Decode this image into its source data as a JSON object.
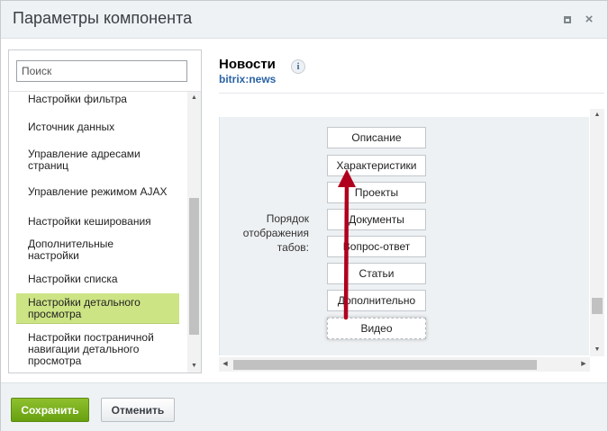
{
  "dialog": {
    "title": "Параметры компонента"
  },
  "titlebar": {
    "maximize_icon": "maximize-icon",
    "close_icon": "close-icon",
    "close_glyph": "×"
  },
  "left": {
    "search_placeholder": "Поиск",
    "items": [
      {
        "label": "Настройки фильтра",
        "selected": false
      },
      {
        "label": "Источник данных",
        "selected": false
      },
      {
        "label": "Управление адресами страниц",
        "selected": false
      },
      {
        "label": "Управление режимом AJAX",
        "selected": false
      },
      {
        "label": "Настройки кеширования",
        "selected": false
      },
      {
        "label": "Дополнительные настройки",
        "selected": false
      },
      {
        "label": "Настройки списка",
        "selected": false
      },
      {
        "label": "Настройки детального просмотра",
        "selected": true
      },
      {
        "label": "Настройки постраничной навигации детального просмотра",
        "selected": false
      }
    ]
  },
  "component": {
    "name": "Новости",
    "code": "bitrix:news",
    "info_glyph": "i"
  },
  "tabs_order": {
    "label": "Порядок отображения табов:",
    "tabs": [
      "Описание",
      "Характеристики",
      "Проекты",
      "Документы",
      "Вопрос-ответ",
      "Статьи",
      "Дополнительно",
      "Видео"
    ],
    "dragging_tab": "Видео"
  },
  "footer": {
    "save_label": "Сохранить",
    "cancel_label": "Отменить"
  },
  "colors": {
    "selected_item": "#cde485",
    "save_button": "#78b01c",
    "annotation_arrow": "#b0001e",
    "link": "#2a63a6"
  }
}
